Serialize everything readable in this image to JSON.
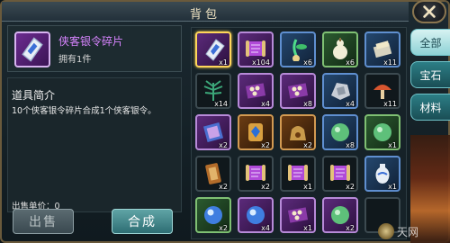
{
  "window": {
    "title": "背包"
  },
  "selected_item": {
    "name": "侠客银令碎片",
    "owned": "拥有1件",
    "desc_title": "道具简介",
    "description": "10个侠客银令碎片合成1个侠客银令。",
    "price": "出售单价：0"
  },
  "buttons": {
    "sell": "出售",
    "craft": "合成"
  },
  "tabs": [
    "全部",
    "宝石",
    "材料"
  ],
  "grid": {
    "slots": [
      {
        "name": "silver-token-shard",
        "count": "x1",
        "rarity": "purple",
        "selected": true,
        "icon": "shard-icon"
      },
      {
        "name": "scroll",
        "count": "x104",
        "rarity": "purple",
        "icon": "scroll-icon"
      },
      {
        "name": "green-herb",
        "count": "x6",
        "rarity": "blue",
        "icon": "herb-icon"
      },
      {
        "name": "white-gourd",
        "count": "x6",
        "rarity": "green",
        "icon": "gourd-icon"
      },
      {
        "name": "pill-box",
        "count": "x11",
        "rarity": "blue",
        "icon": "box-icon"
      },
      {
        "name": "spiky-plant",
        "count": "x14",
        "rarity": "gray",
        "icon": "plant-icon"
      },
      {
        "name": "beads-cloth",
        "count": "x4",
        "rarity": "purple",
        "icon": "beads-icon"
      },
      {
        "name": "beads-cloth-2",
        "count": "x8",
        "rarity": "purple",
        "icon": "beads-icon"
      },
      {
        "name": "silver-ore",
        "count": "x4",
        "rarity": "blue",
        "icon": "ore-icon"
      },
      {
        "name": "red-mushroom",
        "count": "x11",
        "rarity": "gray",
        "icon": "mushroom-icon"
      },
      {
        "name": "manual",
        "count": "x2",
        "rarity": "purple",
        "icon": "book-icon"
      },
      {
        "name": "gem-badge",
        "count": "x2",
        "rarity": "orange",
        "icon": "badge-icon"
      },
      {
        "name": "gold-pouch",
        "count": "x2",
        "rarity": "orange",
        "icon": "pouch-icon"
      },
      {
        "name": "jade-orb",
        "count": "x8",
        "rarity": "blue",
        "icon": "orb-icon"
      },
      {
        "name": "bronze-orb",
        "count": "x1",
        "rarity": "green",
        "icon": "orb-icon"
      },
      {
        "name": "tablet",
        "count": "x2",
        "rarity": "gray",
        "icon": "tablet-icon"
      },
      {
        "name": "red-scroll",
        "count": "x2",
        "rarity": "gray",
        "icon": "scroll-icon"
      },
      {
        "name": "red-scroll-2",
        "count": "x1",
        "rarity": "gray",
        "icon": "scroll-icon"
      },
      {
        "name": "red-scroll-3",
        "count": "x2",
        "rarity": "gray",
        "icon": "scroll-icon"
      },
      {
        "name": "porcelain-vase",
        "count": "x1",
        "rarity": "blue",
        "icon": "vase-icon"
      },
      {
        "name": "blue-pearl",
        "count": "x2",
        "rarity": "green",
        "icon": "pearl-icon"
      },
      {
        "name": "pink-pearl",
        "count": "x4",
        "rarity": "purple",
        "icon": "pearl-icon"
      },
      {
        "name": "gem-cloth",
        "count": "x1",
        "rarity": "purple",
        "icon": "beads-icon"
      },
      {
        "name": "silver-orb",
        "count": "x2",
        "rarity": "purple",
        "icon": "orb-icon"
      },
      {
        "name": "empty",
        "count": "",
        "rarity": "gray",
        "icon": "empty"
      }
    ]
  },
  "watermark": "天网"
}
